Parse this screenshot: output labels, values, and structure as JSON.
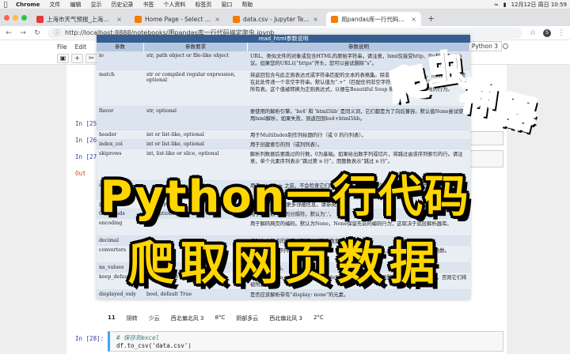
{
  "menubar": {
    "app": "Chrome",
    "items": [
      "文件",
      "编辑",
      "显示",
      "历史记录",
      "书签",
      "个人资料",
      "标签页",
      "窗口",
      "帮助"
    ],
    "datetime": "12月12日 周日 10:59"
  },
  "tabs": [
    {
      "label": "上海市天气预报_上海市10天天...",
      "active": false,
      "color": "#e53935"
    },
    {
      "label": "Home Page - Select or create a...",
      "active": false,
      "color": "#f57c00"
    },
    {
      "label": "data.csv - Jupyter Text Editor",
      "active": false,
      "color": "#f57c00"
    },
    {
      "label": "用pandas库一行代码搞定爬虫 - J...",
      "active": true,
      "color": "#f57c00"
    }
  ],
  "address": {
    "url": "http://localhost:8888/notebooks/用pandas库一行代码搞定爬虫.ipynb",
    "avatar": "S"
  },
  "jupyter": {
    "menu": [
      "File",
      "Edit"
    ],
    "kernel": "Python 3"
  },
  "prompts": [
    "In [25]:",
    "In [26]:",
    "In [27]:",
    "Out"
  ],
  "reference_table": {
    "title": "read_html参数说明",
    "headers": [
      "参数",
      "参数要求",
      "参数说明"
    ],
    "rows": [
      {
        "name": "io",
        "type": "str, path object or file-like object",
        "desc": "URL、类似文件的对象或包含HTML的原始字符串。请注意，lxml仅接受http、ftp和file url协议。如果您的URL以“https”开头，您可以尝试删除“s”。"
      },
      {
        "name": "match",
        "type": "str or compiled regular expression, optional",
        "desc": "将返回包含与此正则表达式或字符串匹配的文本的表格集。除非HTML非常简单，否则您可能需要在此处传递一个非空字符串。默认值为“.+”（匹配任何非空字符串）。默认值将返回页面上包含的所有表。这个值被转换为正则表达式，以便在Beautiful Soup 和 lxml 之间有一致的行为。"
      },
      {
        "name": "flavor",
        "type": "str, optional",
        "desc": "要使用的解析引擎。'bs4' 和 'html5lib' 是同义词，它们都是为了向后兼容。默认值None尝试使用lxml解析，如果失败，则返回到bs4+html5lib。"
      },
      {
        "name": "header",
        "type": "int or list-like, optional",
        "desc": "用于MultiIndex制作列标题的行（或 0 的行列表）。"
      },
      {
        "name": "index_col",
        "type": "int or list-like, optional",
        "desc": "用于创建索引的列（或列列表）。"
      },
      {
        "name": "skiprows",
        "type": "int, list-like or slice, optional",
        "desc": "解析列数据后要跳过的行数。0为基础。如果给出数字列或切片，将跳过由该序列索引的行。请注意，单个元素序列表示“跳过第 n 行”，而整数表示“跳过 n 行”。"
      },
      {
        "name": "attrs",
        "type": "",
        "desc": "用于 <table> 之前，不会检查它们的有效性，它必须是有效的 HTML 表格属性才能正常工作。"
      },
      {
        "name": "parse_dates",
        "type": "bool, optional",
        "desc": "有关read_csv()更多详细信息，请参阅。"
      },
      {
        "name": "thousands",
        "type": "str, optional",
        "desc": "用于解析数千个的分隔符。默认为','。"
      },
      {
        "name": "encoding",
        "type": "",
        "desc": "用于解码网页的编码。默认为None，None保留先前的编码行为，这取决于底层解析器库。"
      },
      {
        "name": "decimal",
        "type": "",
        "desc": "识别为小数点的字符（例如，对欧洲数据使用 ','）。"
      },
      {
        "name": "converters",
        "type": "",
        "desc": "用于转换某些列中的值的函数的字典。键可以是整数或列标签，值是一个输入参数的函数。"
      },
      {
        "name": "na_values",
        "type": "",
        "desc": "自定义 NA 值。"
      },
      {
        "name": "keep_default_na",
        "type": "bool, default True",
        "desc": "如果指定了 na_values 并且 keep_default_na 为 False，则默认 NaN 值将被覆盖，否则它们将被附加到。"
      },
      {
        "name": "displayed_only",
        "type": "bool, default True",
        "desc": "是否应该解析带有“display: none”的元素。"
      }
    ]
  },
  "output_row": [
    "11",
    "阴转",
    "少云",
    "西北偏北风 3",
    "8°C",
    "阴部多云",
    "西北偏北风 3",
    "2°C"
  ],
  "code_cell": {
    "prompt": "In [28]:",
    "comment": "# 保存到excel",
    "code": "df.to_csv('data.csv')"
  },
  "overlay": {
    "stamp_chars": [
      "爬",
      "虫",
      "神",
      "器"
    ],
    "banner_line1": "Python一行代码",
    "banner_line2": "爬取网页数据"
  }
}
